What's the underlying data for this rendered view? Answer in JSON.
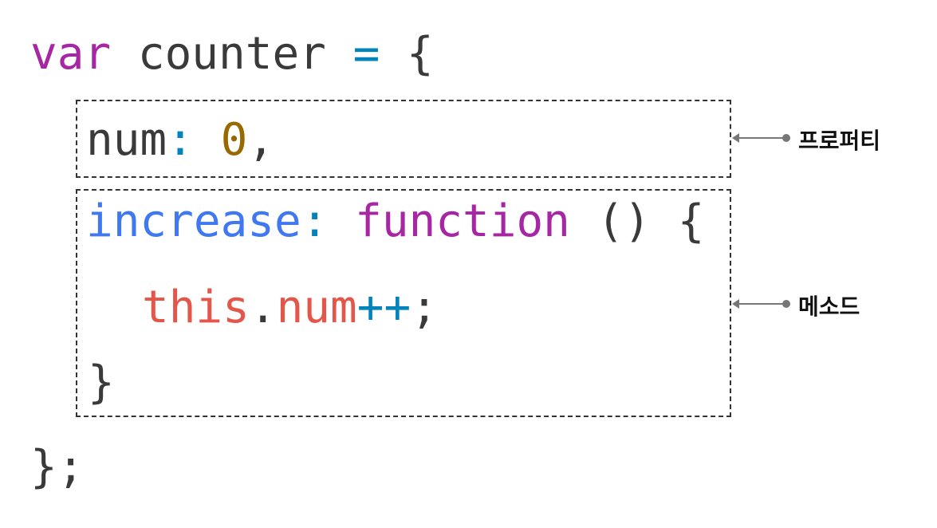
{
  "code": {
    "line1": {
      "kw_var": "var",
      "name": " counter ",
      "eq": "=",
      "brace": " {"
    },
    "line2": {
      "prop": "num",
      "colon": ":",
      "value": " 0",
      "comma": ","
    },
    "line3": {
      "prop": "increase",
      "colon": ":",
      "kw_function": " function",
      "parens": " () {"
    },
    "line4": {
      "this": "this",
      "dot": ".",
      "prop": "num",
      "op": "++",
      "semi": ";"
    },
    "line5": {
      "close": "}"
    },
    "line6": {
      "close": "};"
    }
  },
  "annotations": {
    "property": "프로퍼티",
    "method": "메소드"
  },
  "colors": {
    "keyword": "#a626a4",
    "property": "#4078f2",
    "operator": "#0184bc",
    "number": "#986801",
    "this": "#e45649",
    "text": "#3a3a3a"
  }
}
